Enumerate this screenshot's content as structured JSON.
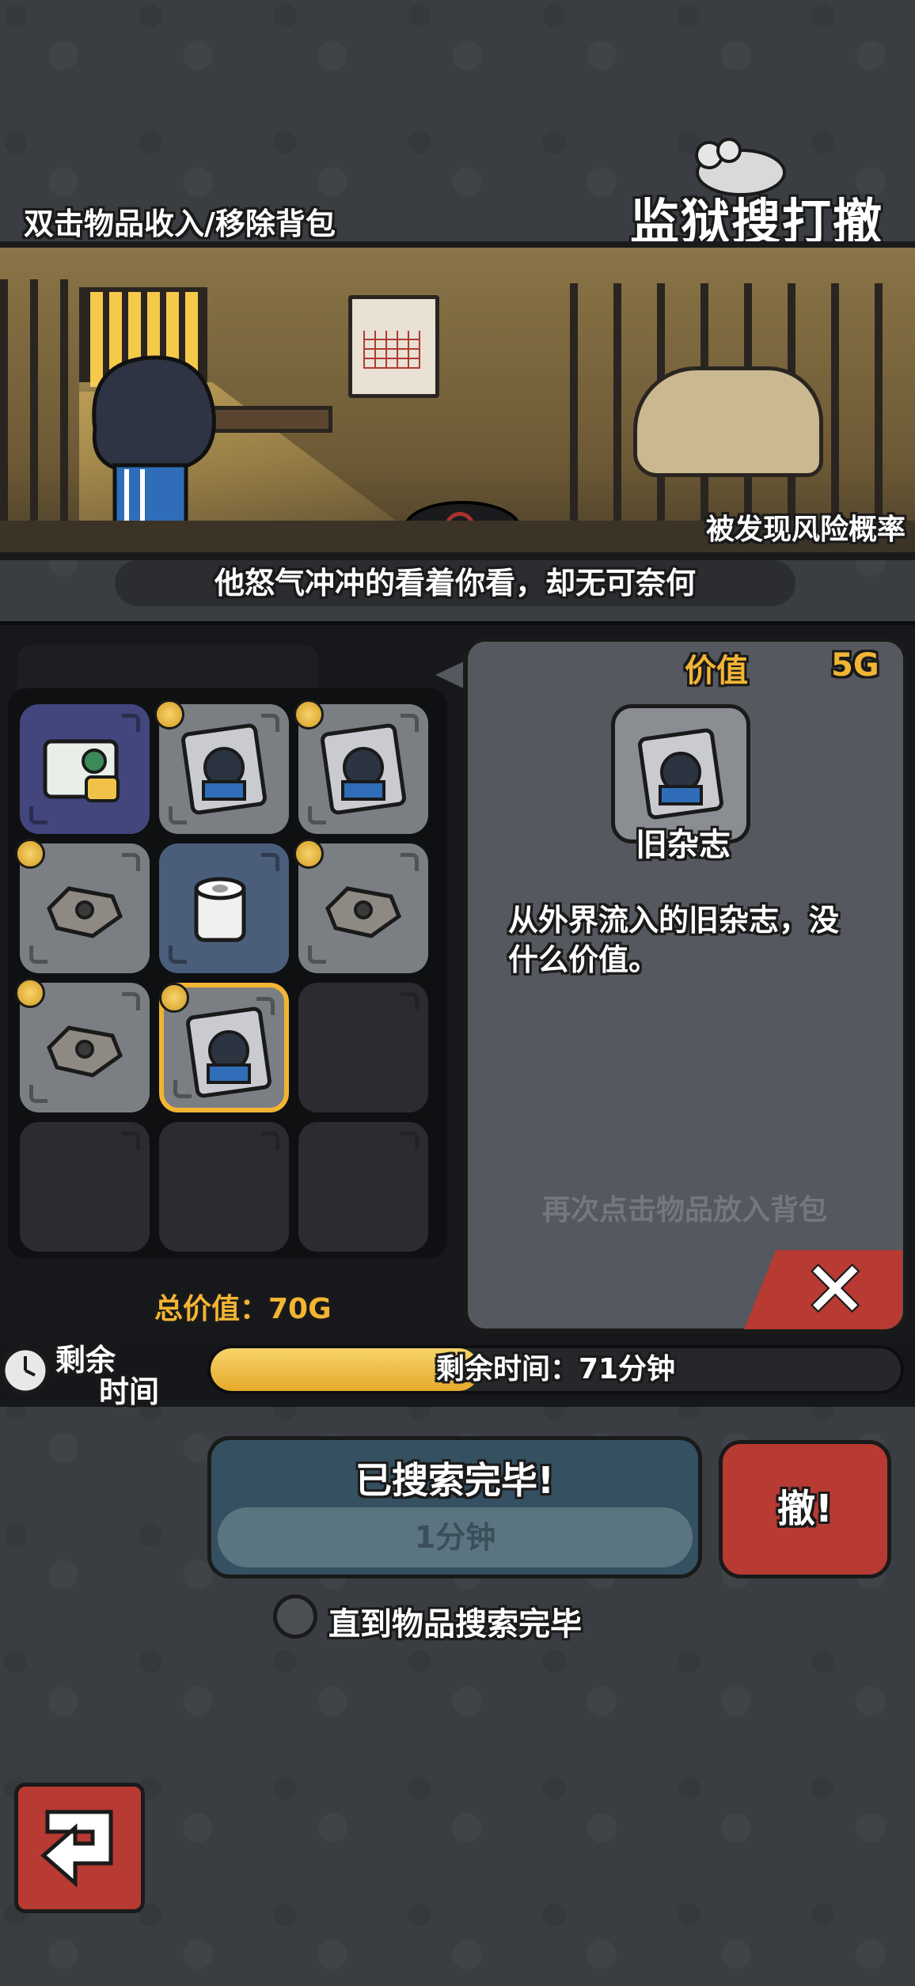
{
  "header": {
    "hint": "双击物品收入/移除背包",
    "logo": "监狱搜打撤"
  },
  "scene": {
    "risk_label": "被发现风险概率",
    "speech": "他怒气冲冲的看着你看，却无可奈何"
  },
  "loot": {
    "total_value": "总价值：70G",
    "slots": [
      {
        "item": "document-card",
        "coin": false,
        "bg": "purple"
      },
      {
        "item": "magazine",
        "coin": true,
        "bg": "gray"
      },
      {
        "item": "magazine",
        "coin": true,
        "bg": "gray"
      },
      {
        "item": "scrap-metal",
        "coin": true,
        "bg": "gray"
      },
      {
        "item": "toilet-paper",
        "coin": false,
        "bg": "blue"
      },
      {
        "item": "scrap-metal",
        "coin": true,
        "bg": "gray"
      },
      {
        "item": "scrap-metal",
        "coin": true,
        "bg": "gray"
      },
      {
        "item": "magazine",
        "coin": true,
        "bg": "gray",
        "selected": true
      },
      {
        "item": "empty"
      },
      {
        "item": "empty"
      },
      {
        "item": "empty"
      },
      {
        "item": "empty"
      }
    ]
  },
  "detail": {
    "value_label": "价值",
    "value_amount": "5G",
    "item_name": "旧杂志",
    "description": "从外界流入的旧杂志，没什么价值。",
    "reclick_hint": "再次点击物品放入背包"
  },
  "timer": {
    "label_line1": "剩余",
    "label_line2": "时间",
    "text": "剩余时间：71分钟",
    "progress": 0.39
  },
  "search": {
    "title": "已搜索完毕!",
    "subtitle": "1分钟",
    "escape": "撤!",
    "until_done": "直到物品搜索完毕"
  },
  "colors": {
    "accent_gold": "#f2b533",
    "danger_red": "#b73a33"
  }
}
